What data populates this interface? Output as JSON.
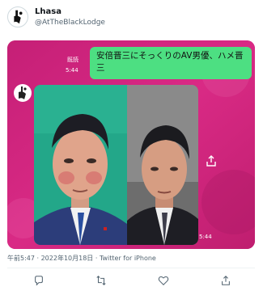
{
  "author": {
    "display_name": "Lhasa",
    "handle": "@AtTheBlackLodge",
    "avatar_icon": "abstract-logo-icon"
  },
  "media": {
    "message_text": "安倍晋三にそっくりのAV男優、ハメ晋三",
    "read_label": "既読",
    "message_time": "5:44",
    "photo_time": "5:44",
    "background_color": "#d4227a",
    "bubble_color": "#4ddf82"
  },
  "tweet_meta": {
    "timestamp": "午前5:47 · 2022年10月18日 · Twitter for iPhone"
  },
  "actions": {
    "icons": [
      "reply-icon",
      "retweet-icon",
      "like-icon",
      "share-icon"
    ]
  }
}
